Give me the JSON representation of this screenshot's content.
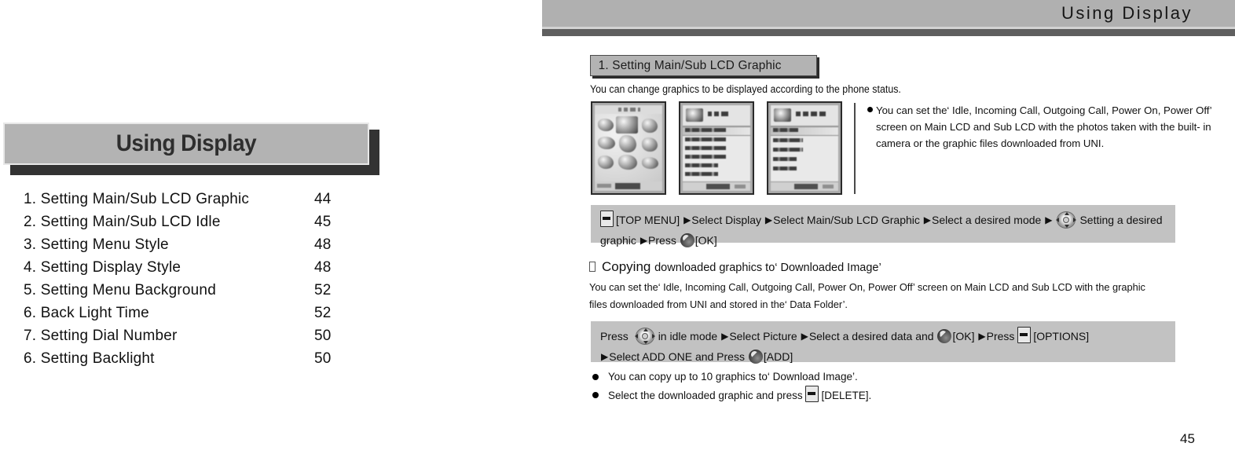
{
  "left_page": {
    "chapter_title": "Using Display",
    "toc": [
      {
        "label": "1. Setting Main/Sub LCD Graphic",
        "page": "44"
      },
      {
        "label": "2. Setting Main/Sub LCD Idle",
        "page": "45"
      },
      {
        "label": "3. Setting Menu Style",
        "page": "48"
      },
      {
        "label": "4. Setting Display Style",
        "page": "48"
      },
      {
        "label": "5. Setting Menu Background",
        "page": "52"
      },
      {
        "label": "6. Back Light Time",
        "page": "52"
      },
      {
        "label": "7. Setting Dial Number",
        "page": "50"
      },
      {
        "label": "6. Setting Backlight",
        "page": "50"
      }
    ]
  },
  "right_page": {
    "running_header": "Using Display",
    "section_heading": "1. Setting Main/Sub LCD Graphic",
    "section_intro": "You can change graphics to be displayed according to the phone status.",
    "graphic_note": "You can set the‘ Idle, Incoming Call, Outgoing Call, Power On, Power Off’ screen on Main LCD and Sub LCD with the photos taken with the built- in camera or the graphic files downloaded from UNI.",
    "step_box_1": {
      "softkey_icon": "softkey-button-icon",
      "part1": "[TOP MENU]",
      "arrow": "▶",
      "part2": "Select Display",
      "part3": "Select Main/Sub LCD Graphic",
      "part4": "Select a desired mode",
      "navkey_icon": "navigation-pad-icon",
      "part5": "Setting a desired graphic",
      "part6": "Press",
      "okkey_icon": "ok-button-icon",
      "part7": "[OK]"
    },
    "copy_heading_main": "Copying",
    "copy_heading_sub": "downloaded graphics to‘ Downloaded Image’",
    "copy_body": "You can set the‘ Idle, Incoming Call, Outgoing Call, Power On, Power Off’ screen on Main LCD and Sub LCD with the graphic files downloaded from UNI and stored in the‘ Data Folder’.",
    "step_box_2": {
      "part1": "Press",
      "navkey_icon": "navigation-pad-icon",
      "part2": "in idle mode",
      "arrow": "▶",
      "part3": "Select Picture",
      "part4": "Select a desired data and",
      "okkey_icon": "ok-button-icon",
      "part5": "[OK]",
      "part6": "Press",
      "softkey_icon": "softkey-button-icon",
      "part7": "[OPTIONS]",
      "part8": "Select ADD ONE and Press",
      "part9": "[ADD]"
    },
    "bottom_notes": [
      {
        "text": "You can copy up to 10 graphics to‘ Download Image’."
      },
      {
        "text_before": "Select the downloaded graphic and press",
        "key_icon": "softkey-button-icon",
        "text_after": "[DELETE]."
      }
    ],
    "page_number": "45"
  },
  "colors": {
    "header_bar": "#b0b0b0",
    "header_rule_dark": "#5f5f5f",
    "title_box": "#b3b3b3",
    "title_shadow": "#333333",
    "step_box": "#c2c2c2",
    "text": "#111111"
  }
}
